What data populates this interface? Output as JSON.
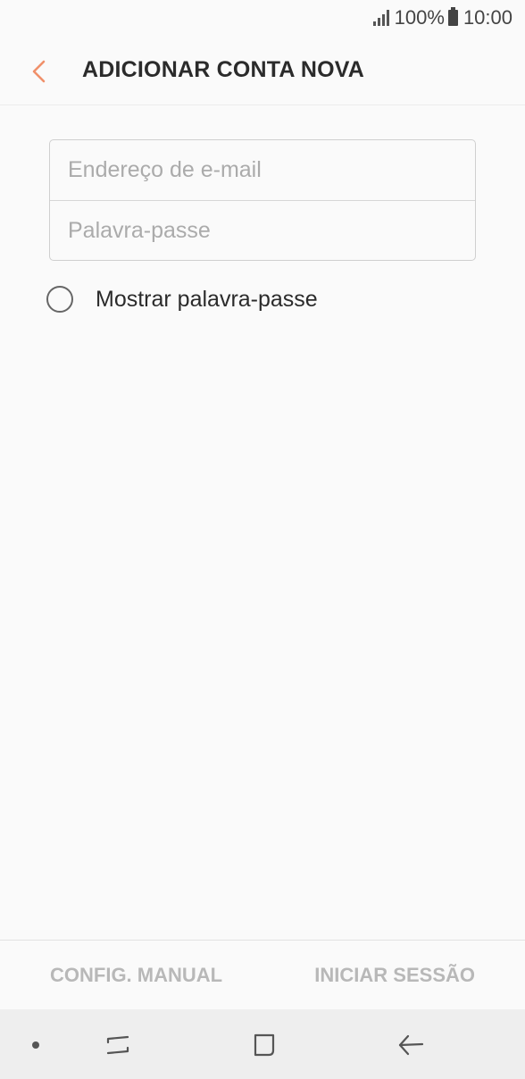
{
  "status_bar": {
    "battery_percent": "100%",
    "time": "10:00"
  },
  "header": {
    "title": "ADICIONAR CONTA NOVA",
    "back_icon": "chevron-left-icon",
    "accent_color": "#f0906a"
  },
  "form": {
    "email_placeholder": "Endereço de e-mail",
    "email_value": "",
    "password_placeholder": "Palavra-passe",
    "password_value": ""
  },
  "show_password": {
    "label": "Mostrar palavra-passe",
    "checked": false
  },
  "actions": {
    "manual_label": "CONFIG. MANUAL",
    "signin_label": "INICIAR SESSÃO"
  },
  "nav_bar": {
    "icons": [
      "dot-icon",
      "recent-apps-icon",
      "home-icon",
      "back-arrow-icon"
    ]
  }
}
